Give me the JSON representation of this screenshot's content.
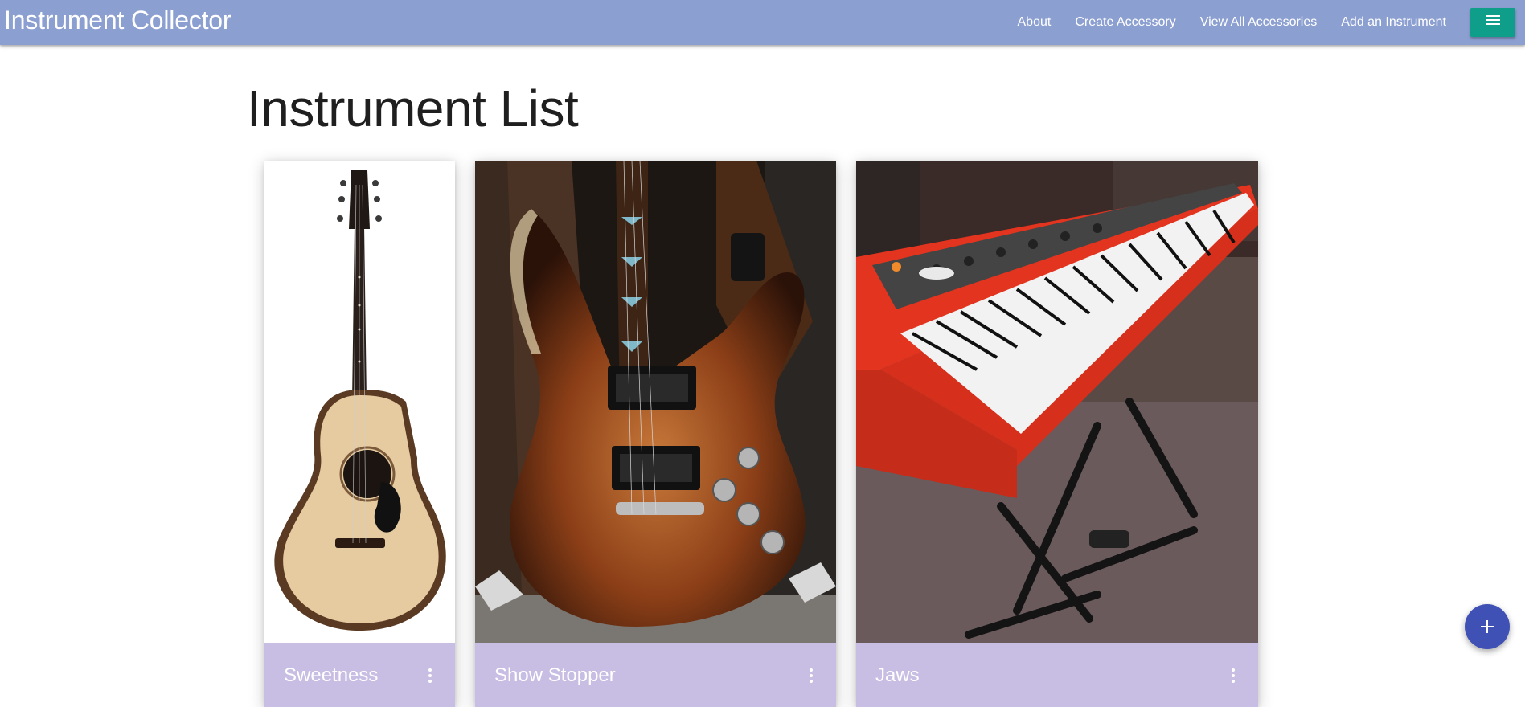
{
  "app": {
    "brand": "Instrument Collector"
  },
  "nav": {
    "links": [
      {
        "label": "About"
      },
      {
        "label": "Create Accessory"
      },
      {
        "label": "View All Accessories"
      },
      {
        "label": "Add an Instrument"
      }
    ],
    "menu_icon": "hamburger-menu-icon",
    "menu_color": "#0e9e8a",
    "bar_color": "#8c9fd1"
  },
  "main": {
    "title": "Instrument List",
    "cards": [
      {
        "name": "Sweetness",
        "image": "acoustic-guitar-photo"
      },
      {
        "name": "Show Stopper",
        "image": "electric-guitar-photo"
      },
      {
        "name": "Jaws",
        "image": "red-stage-piano-photo"
      }
    ]
  },
  "fab": {
    "icon": "plus-icon",
    "color": "#3f51b5"
  }
}
